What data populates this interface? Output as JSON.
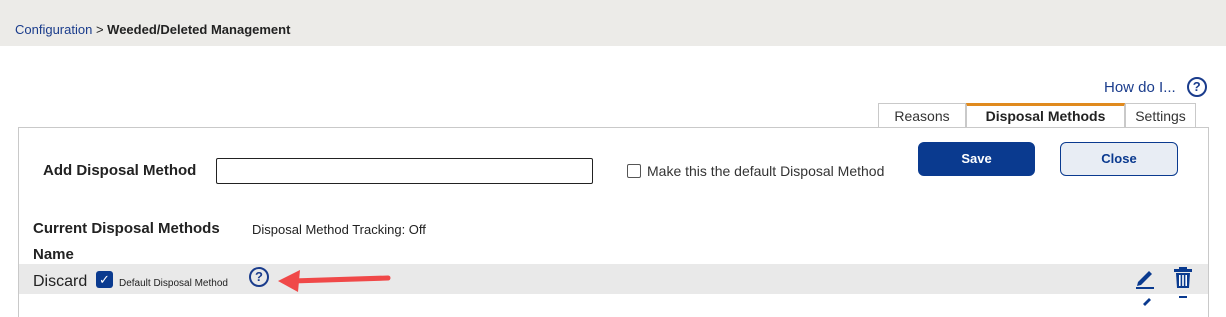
{
  "breadcrumb": {
    "parent": "Configuration",
    "separator": ">",
    "current": "Weeded/Deleted Management"
  },
  "help": {
    "how_do_i": "How do I...",
    "icon_glyph": "?"
  },
  "tabs": [
    {
      "label": "Reasons",
      "active": false
    },
    {
      "label": "Disposal Methods",
      "active": true
    },
    {
      "label": "Settings",
      "active": false
    }
  ],
  "form": {
    "add_label": "Add Disposal Method",
    "input_value": "",
    "default_checkbox_label": "Make this the default Disposal Method",
    "default_checked": false,
    "save_label": "Save",
    "close_label": "Close"
  },
  "current": {
    "title": "Current Disposal Methods",
    "tracking": "Disposal Method Tracking: Off",
    "name_header": "Name"
  },
  "rows": [
    {
      "name": "Discard",
      "is_default": true,
      "default_label": "Default Disposal Method"
    }
  ],
  "colors": {
    "accent_blue": "#0a3a8f",
    "tab_highlight": "#e08a1e",
    "annotation_arrow": "#f04848"
  }
}
